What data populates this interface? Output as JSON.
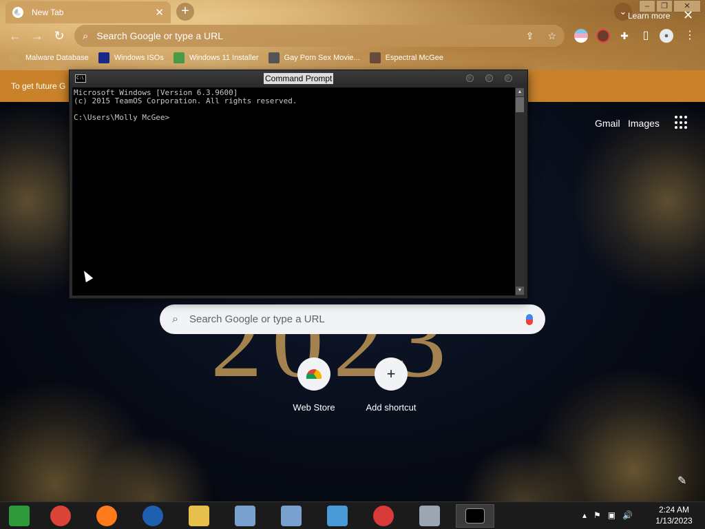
{
  "browser": {
    "tab": {
      "title": "New Tab",
      "close_glyph": "✕"
    },
    "new_tab_glyph": "+",
    "tab_search_glyph": "⌄",
    "window_controls": {
      "minimize": "–",
      "restore": "❐",
      "close": "✕"
    },
    "nav": {
      "back": "←",
      "forward": "→",
      "reload": "↻"
    },
    "omnibox": {
      "search_glyph": "⌕",
      "placeholder": "Search Google or type a URL",
      "share_glyph": "⇪",
      "star_glyph": "☆"
    },
    "toolbar_icons": [
      "extension-flag-icon",
      "profile-extension-icon",
      "puzzle-icon",
      "sidepanel-icon",
      "profile-icon",
      "menu-icon"
    ],
    "puzzle_glyph": "✚",
    "sidepanel_glyph": "▯",
    "profile_glyph": "●",
    "menu_glyph": "⋮",
    "bookmarks": [
      {
        "label": "Malware Database",
        "icon": "malware-bookmark-icon",
        "color": "#c9a060"
      },
      {
        "label": "Windows ISOs",
        "icon": "windows-isos-bookmark-icon",
        "color": "#1a2a8a"
      },
      {
        "label": "Windows 11 Installer",
        "icon": "installer-bookmark-icon",
        "color": "#4a9a4a"
      },
      {
        "label": "Gay Porn Sex Movie...",
        "icon": "site-bookmark-icon",
        "color": "#555555"
      },
      {
        "label": "Espectral McGee",
        "icon": "espectral-bookmark-icon",
        "color": "#6a4a3a"
      }
    ]
  },
  "promo": {
    "text": "To get future G",
    "learn_more": "Learn more",
    "close_glyph": "✕"
  },
  "ntp": {
    "links": {
      "gmail": "Gmail",
      "images": "Images"
    },
    "year": "2023",
    "search": {
      "glyph": "⌕",
      "placeholder": "Search Google or type a URL"
    },
    "shortcuts": [
      {
        "label": "Web Store",
        "glyph": "◔"
      },
      {
        "label": "Add shortcut",
        "glyph": "+"
      }
    ],
    "edit_glyph": "✎"
  },
  "cmd": {
    "title": "Command Prompt",
    "icon_text": "C:\\",
    "lines": "Microsoft Windows [Version 6.3.9600]\n(c) 2015 TeamOS Corporation. All rights reserved.\n\nC:\\Users\\Molly McGee>",
    "scroll_up": "▲",
    "scroll_down": "▼"
  },
  "taskbar": {
    "items": [
      {
        "name": "explorer-shortcut-icon",
        "color": "#2f9a3a"
      },
      {
        "name": "chrome-taskbar-icon",
        "color": "#db4437"
      },
      {
        "name": "firefox-taskbar-icon",
        "color": "#ff7a1a"
      },
      {
        "name": "obama-logo-taskbar-icon",
        "color": "#1f5fb0"
      },
      {
        "name": "file-explorer-taskbar-icon",
        "color": "#e6c04a"
      },
      {
        "name": "installer-taskbar-icon",
        "color": "#7aa0d0"
      },
      {
        "name": "installer2-taskbar-icon",
        "color": "#7aa0d0"
      },
      {
        "name": "people-taskbar-icon",
        "color": "#4a9ad8"
      },
      {
        "name": "red-app-taskbar-icon",
        "color": "#d83a3a"
      },
      {
        "name": "monitor-taskbar-icon",
        "color": "#9aa6b4"
      },
      {
        "name": "cmd-taskbar-icon",
        "color": "#000000"
      }
    ],
    "tray": {
      "chevron": "▴",
      "flag": "⚑",
      "network": "▣",
      "volume": "🔊"
    },
    "clock": {
      "time": "2:24 AM",
      "date": "1/13/2023"
    }
  }
}
